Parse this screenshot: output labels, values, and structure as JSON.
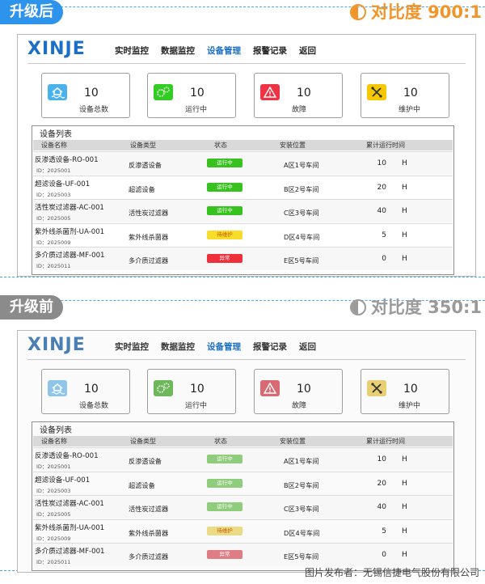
{
  "after": {
    "badge": "升级后",
    "contrast_label": "对比度 900:1",
    "logo": "XINJE",
    "nav": [
      "实时监控",
      "数据监控",
      "设备管理",
      "报警记录",
      "返回"
    ],
    "cards": [
      {
        "num": "10",
        "label": "设备总数",
        "icon": "house-water-icon",
        "color": "#4ab2ea"
      },
      {
        "num": "10",
        "label": "运行中",
        "icon": "gears-icon",
        "color": "#33cc22"
      },
      {
        "num": "10",
        "label": "故障",
        "icon": "warning-icon",
        "color": "#ee3344"
      },
      {
        "num": "10",
        "label": "维护中",
        "icon": "tools-icon",
        "color": "#f5c800"
      }
    ],
    "list_title": "设备列表",
    "headers": [
      "设备名称",
      "设备类型",
      "状态",
      "安装位置",
      "累计运行时间"
    ],
    "rows": [
      {
        "name": "反渗透设备-RO-001",
        "id": "ID：2025001",
        "type": "反渗透设备",
        "status": "运行中",
        "loc": "A区1号车间",
        "hours": "10",
        "unit": "H"
      },
      {
        "name": "超滤设备-UF-001",
        "id": "ID：2025003",
        "type": "超滤设备",
        "status": "运行中",
        "loc": "B区2号车间",
        "hours": "20",
        "unit": "H"
      },
      {
        "name": "活性炭过滤器-AC-001",
        "id": "ID：2025005",
        "type": "活性炭过滤器",
        "status": "运行中",
        "loc": "C区3号车间",
        "hours": "40",
        "unit": "H"
      },
      {
        "name": "紫外线杀菌剂-UA-001",
        "id": "ID：2025009",
        "type": "紫外线杀菌器",
        "status": "待维护",
        "loc": "D区4号车间",
        "hours": "5",
        "unit": "H"
      },
      {
        "name": "多介质过滤器-MF-001",
        "id": "ID：2025011",
        "type": "多介质过滤器",
        "status": "异常",
        "loc": "E区5号车间",
        "hours": "0",
        "unit": "H"
      }
    ],
    "status_colors": {
      "运行中": "#37c21f",
      "待维护": "#f7dc2a",
      "异常": "#ef2f3c"
    },
    "accent": "#2e93ea"
  },
  "before": {
    "badge": "升级前",
    "contrast_label": "对比度 350:1",
    "logo": "XINJE",
    "nav": [
      "实时监控",
      "数据监控",
      "设备管理",
      "报警记录",
      "返回"
    ],
    "cards": [
      {
        "num": "10",
        "label": "设备总数",
        "icon": "house-water-icon",
        "color": "#8ec5ea"
      },
      {
        "num": "10",
        "label": "运行中",
        "icon": "gears-icon",
        "color": "#6db85a"
      },
      {
        "num": "10",
        "label": "故障",
        "icon": "warning-icon",
        "color": "#d86a74"
      },
      {
        "num": "10",
        "label": "维护中",
        "icon": "tools-icon",
        "color": "#e9cf73"
      }
    ],
    "list_title": "设备列表",
    "headers": [
      "设备名称",
      "设备类型",
      "状态",
      "安装位置",
      "累计运行时间"
    ],
    "rows": [
      {
        "name": "反渗透设备-RO-001",
        "id": "ID：2025001",
        "type": "反渗透设备",
        "status": "运行中",
        "loc": "A区1号车间",
        "hours": "10",
        "unit": "H"
      },
      {
        "name": "超滤设备-UF-001",
        "id": "ID：2025003",
        "type": "超滤设备",
        "status": "运行中",
        "loc": "B区2号车间",
        "hours": "20",
        "unit": "H"
      },
      {
        "name": "活性炭过滤器-AC-001",
        "id": "ID：2025005",
        "type": "活性炭过滤器",
        "status": "运行中",
        "loc": "C区3号车间",
        "hours": "40",
        "unit": "H"
      },
      {
        "name": "紫外线杀菌剂-UA-001",
        "id": "ID：2025009",
        "type": "紫外线杀菌器",
        "status": "待维护",
        "loc": "D区4号车间",
        "hours": "5",
        "unit": "H"
      },
      {
        "name": "多介质过滤器-MF-001",
        "id": "ID：2025011",
        "type": "多介质过滤器",
        "status": "异常",
        "loc": "E区5号车间",
        "hours": "0",
        "unit": "H"
      }
    ],
    "status_colors": {
      "运行中": "#8fcc7c",
      "待维护": "#ecdb86",
      "异常": "#de7d86"
    },
    "accent": "#8b8b8b"
  },
  "credit": "图片发布者：无锡信捷电气股份有限公司"
}
